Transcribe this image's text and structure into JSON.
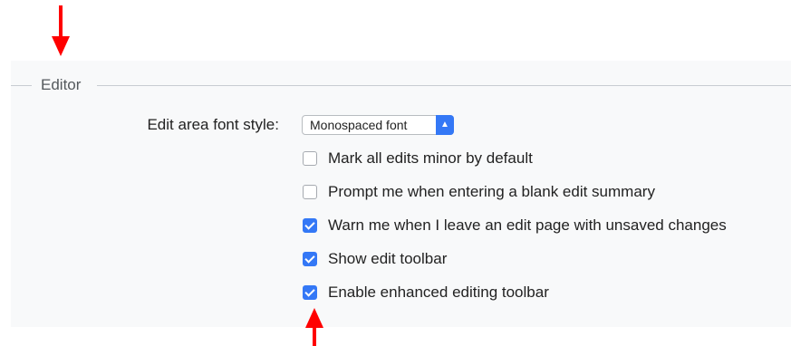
{
  "section": {
    "legend": "Editor"
  },
  "font_style": {
    "label": "Edit area font style:",
    "selected": "Monospaced font"
  },
  "options": [
    {
      "label": "Mark all edits minor by default",
      "checked": false
    },
    {
      "label": "Prompt me when entering a blank edit summary",
      "checked": false
    },
    {
      "label": "Warn me when I leave an edit page with unsaved changes",
      "checked": true
    },
    {
      "label": "Show edit toolbar",
      "checked": true
    },
    {
      "label": "Enable enhanced editing toolbar",
      "checked": true
    }
  ],
  "colors": {
    "annotation": "#ff0000",
    "accent": "#3478f6",
    "panel_bg": "#f8f9fa"
  }
}
